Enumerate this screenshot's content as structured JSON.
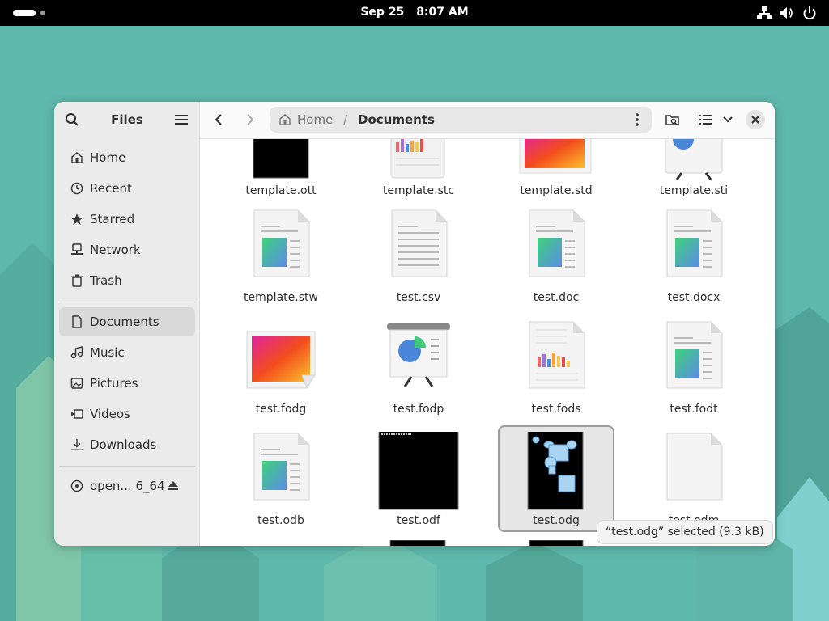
{
  "topbar": {
    "date": "Sep 25",
    "time": "8:07 AM",
    "icons": [
      "network-icon",
      "volume-icon",
      "power-icon"
    ]
  },
  "sidebar": {
    "title": "Files",
    "places": [
      {
        "label": "Home",
        "icon": "home-icon"
      },
      {
        "label": "Recent",
        "icon": "clock-icon"
      },
      {
        "label": "Starred",
        "icon": "star-icon"
      },
      {
        "label": "Network",
        "icon": "network-icon"
      },
      {
        "label": "Trash",
        "icon": "trash-icon"
      }
    ],
    "bookmarks": [
      {
        "label": "Documents",
        "icon": "document-icon",
        "active": true
      },
      {
        "label": "Music",
        "icon": "music-icon"
      },
      {
        "label": "Pictures",
        "icon": "picture-icon"
      },
      {
        "label": "Videos",
        "icon": "video-icon"
      },
      {
        "label": "Downloads",
        "icon": "download-icon"
      }
    ],
    "devices": [
      {
        "label": "open... 6_64",
        "icon": "disc-icon"
      }
    ]
  },
  "pathbar": {
    "home": "Home",
    "separator": "/",
    "current": "Documents"
  },
  "files": [
    {
      "name": "template.ott",
      "type": "black"
    },
    {
      "name": "template.stc",
      "type": "spreadsheet"
    },
    {
      "name": "template.std",
      "type": "drawing"
    },
    {
      "name": "template.sti",
      "type": "presentation"
    },
    {
      "name": "template.stw",
      "type": "text"
    },
    {
      "name": "test.csv",
      "type": "plain"
    },
    {
      "name": "test.doc",
      "type": "text"
    },
    {
      "name": "test.docx",
      "type": "text"
    },
    {
      "name": "test.fodg",
      "type": "drawing"
    },
    {
      "name": "test.fodp",
      "type": "presentation"
    },
    {
      "name": "test.fods",
      "type": "spreadsheet"
    },
    {
      "name": "test.fodt",
      "type": "text"
    },
    {
      "name": "test.odb",
      "type": "text"
    },
    {
      "name": "test.odf",
      "type": "black"
    },
    {
      "name": "test.odg",
      "type": "odg",
      "selected": true
    },
    {
      "name": "test.odm",
      "type": "blank"
    }
  ],
  "status": "“test.odg” selected  (9.3 kB)",
  "colors": {
    "desktop": "#5fb8ac",
    "window": "#ffffff",
    "sidebar": "#ebebeb"
  }
}
